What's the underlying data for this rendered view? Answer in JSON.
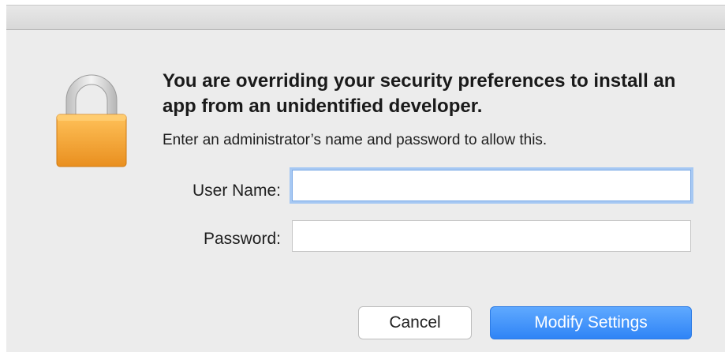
{
  "dialog": {
    "headline": "You are overriding your security preferences to install an app from an unidentified developer.",
    "subtext": "Enter an administrator’s name and password to allow this.",
    "icon": "lock-icon",
    "fields": {
      "username_label": "User Name:",
      "username_value": "",
      "password_label": "Password:",
      "password_value": ""
    },
    "buttons": {
      "cancel_label": "Cancel",
      "modify_label": "Modify Settings"
    },
    "colors": {
      "primary_button": "#2f84f6",
      "focus_ring": "#a6c8f3",
      "lock_body": "#f3a93b",
      "lock_shackle": "#d4d4d4"
    }
  }
}
